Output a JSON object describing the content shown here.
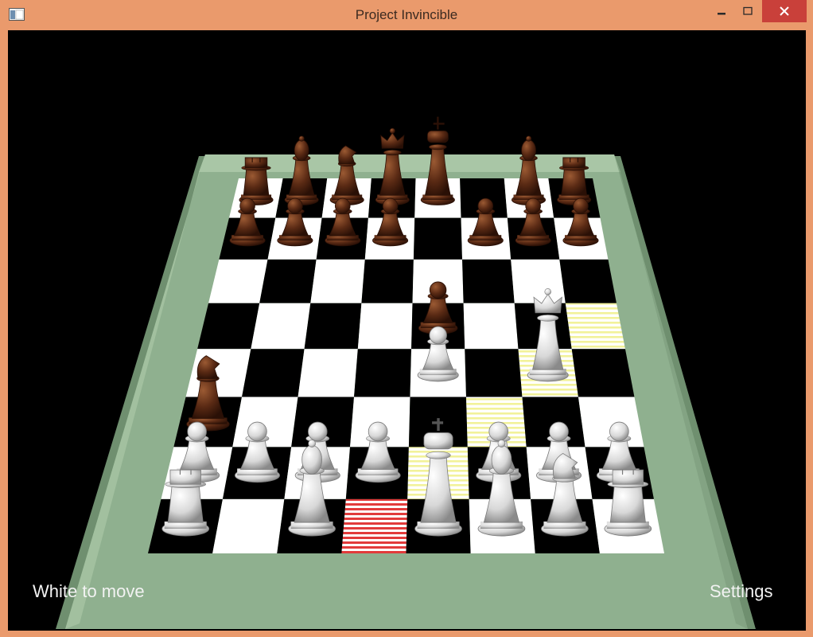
{
  "window": {
    "title": "Project Invincible",
    "controls": {
      "minimize": "minimize-icon",
      "maximize": "maximize-icon",
      "close": "close-icon"
    }
  },
  "colors": {
    "frame": "#ea9a6c",
    "close": "#c9403a",
    "viewport": "#000000",
    "board_rim": "#8fb08f",
    "dark_square": "#000000",
    "light_square": "#ffffff",
    "highlight_move": "#f2f29a",
    "highlight_selected": "#e23b3b",
    "white_piece": "#e4e4e4",
    "black_piece": "#5a2a14"
  },
  "game": {
    "status": "White to move",
    "settings_label": "Settings",
    "selected_square": "d1",
    "move_highlights": [
      "e2",
      "f3",
      "g4",
      "h5"
    ],
    "pieces": [
      {
        "square": "a8",
        "type": "rook",
        "color": "black"
      },
      {
        "square": "b8",
        "type": "bishop",
        "color": "black"
      },
      {
        "square": "c8",
        "type": "knight",
        "color": "black"
      },
      {
        "square": "d8",
        "type": "queen",
        "color": "black"
      },
      {
        "square": "e8",
        "type": "king",
        "color": "black"
      },
      {
        "square": "g8",
        "type": "bishop",
        "color": "black"
      },
      {
        "square": "h8",
        "type": "rook",
        "color": "black"
      },
      {
        "square": "a7",
        "type": "pawn",
        "color": "black"
      },
      {
        "square": "b7",
        "type": "pawn",
        "color": "black"
      },
      {
        "square": "c7",
        "type": "pawn",
        "color": "black"
      },
      {
        "square": "d7",
        "type": "pawn",
        "color": "black"
      },
      {
        "square": "f7",
        "type": "pawn",
        "color": "black"
      },
      {
        "square": "g7",
        "type": "pawn",
        "color": "black"
      },
      {
        "square": "h7",
        "type": "pawn",
        "color": "black"
      },
      {
        "square": "e5",
        "type": "pawn",
        "color": "black"
      },
      {
        "square": "a3",
        "type": "knight",
        "color": "black"
      },
      {
        "square": "e4",
        "type": "pawn",
        "color": "white"
      },
      {
        "square": "g4",
        "type": "queen",
        "color": "white"
      },
      {
        "square": "a2",
        "type": "pawn",
        "color": "white"
      },
      {
        "square": "b2",
        "type": "pawn",
        "color": "white"
      },
      {
        "square": "c2",
        "type": "pawn",
        "color": "white"
      },
      {
        "square": "d2",
        "type": "pawn",
        "color": "white"
      },
      {
        "square": "f2",
        "type": "pawn",
        "color": "white"
      },
      {
        "square": "g2",
        "type": "pawn",
        "color": "white"
      },
      {
        "square": "h2",
        "type": "pawn",
        "color": "white"
      },
      {
        "square": "a1",
        "type": "rook",
        "color": "white"
      },
      {
        "square": "c1",
        "type": "bishop",
        "color": "white"
      },
      {
        "square": "e1",
        "type": "king",
        "color": "white"
      },
      {
        "square": "f1",
        "type": "bishop",
        "color": "white"
      },
      {
        "square": "g1",
        "type": "knight",
        "color": "white"
      },
      {
        "square": "h1",
        "type": "rook",
        "color": "white"
      }
    ]
  }
}
